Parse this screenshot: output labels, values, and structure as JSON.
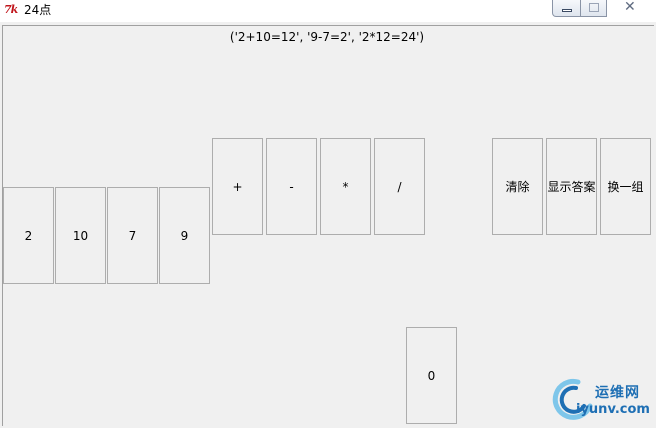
{
  "window": {
    "title": "24点",
    "app_icon_text": "7k",
    "background_blur_left": "",
    "background_blur_right": ""
  },
  "answer": {
    "text": "('2+10=12', '9-7=2', '2*12=24')"
  },
  "cards": [
    {
      "label": "2"
    },
    {
      "label": "10"
    },
    {
      "label": "7"
    },
    {
      "label": "9"
    }
  ],
  "operators": [
    {
      "label": "+"
    },
    {
      "label": "-"
    },
    {
      "label": "*"
    },
    {
      "label": "/"
    }
  ],
  "controls": {
    "clear_label": "清除",
    "show_answer_label": "显示答案",
    "new_set_label": "换一组"
  },
  "result": {
    "label": "0"
  },
  "watermark": {
    "top_text": "运维网",
    "bottom_text": "iyunv.com"
  },
  "colors": {
    "window_bg": "#f0f0f0",
    "button_border": "#adadad",
    "logo_blue": "#1e6fb4"
  }
}
